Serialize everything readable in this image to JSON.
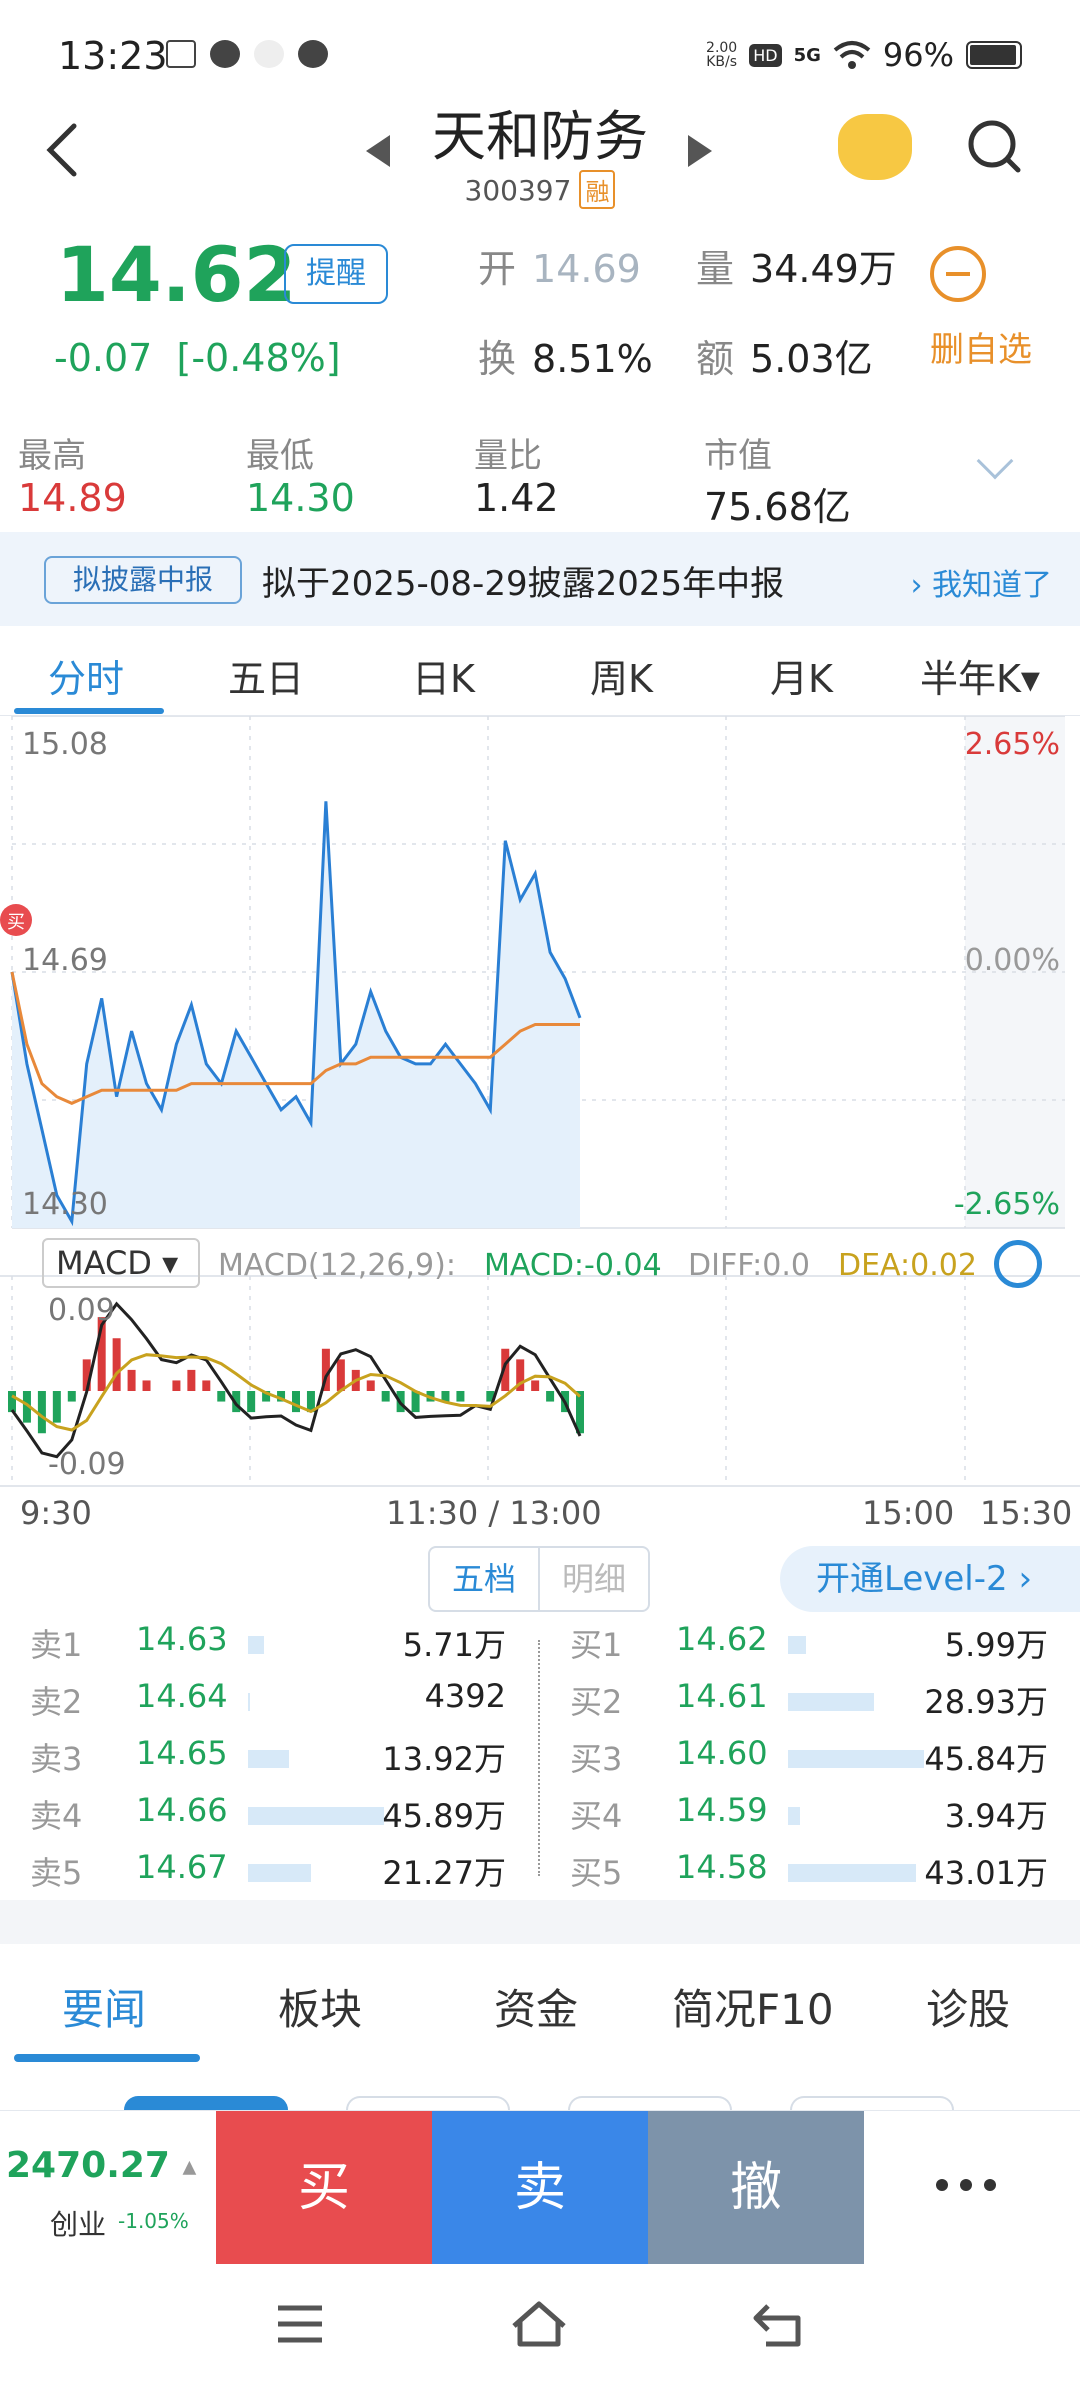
{
  "status_bar": {
    "time": "13:23",
    "net_speed_top": "2.00",
    "net_speed_bottom": "KB/s",
    "hd": "HD",
    "signal": "5G",
    "battery": "96%"
  },
  "header": {
    "stock_name": "天和防务",
    "stock_code": "300397",
    "margin_tag": "融"
  },
  "quote": {
    "price": "14.62",
    "remind_label": "提醒",
    "change": "-0.07",
    "change_pct": "[-0.48%]",
    "open_label": "开",
    "open_value": "14.69",
    "volume_label": "量",
    "volume_value": "34.49万",
    "turnover_label": "换",
    "turnover_value": "8.51%",
    "amount_label": "额",
    "amount_value": "5.03亿",
    "remove_watch_label": "删自选"
  },
  "stats": [
    {
      "label": "最高",
      "value": "14.89",
      "color": "#d93a3a"
    },
    {
      "label": "最低",
      "value": "14.30",
      "color": "#1fa35b"
    },
    {
      "label": "量比",
      "value": "1.42",
      "color": "#222222"
    },
    {
      "label": "市值",
      "value": "75.68亿",
      "color": "#222222"
    }
  ],
  "banner": {
    "tag": "拟披露中报",
    "text": "拟于2025-08-29披露2025年中报",
    "action": "我知道了"
  },
  "period_tabs": [
    "分时",
    "五日",
    "日K",
    "周K",
    "月K",
    "半年K▾"
  ],
  "price_chart": {
    "y_top": "15.08",
    "y_mid": "14.69",
    "y_bottom": "14.30",
    "pct_top": "2.65%",
    "pct_mid": "0.00%",
    "pct_bottom": "-2.65%",
    "marker": "买"
  },
  "macd": {
    "selector": "MACD",
    "params": "MACD(12,26,9):",
    "macd_value": "MACD:-0.04",
    "diff_value": "DIFF:0.0",
    "dea_value": "DEA:0.02",
    "y_top": "0.09",
    "y_bottom": "-0.09"
  },
  "time_axis": [
    "9:30",
    "11:30 / 13:00",
    "15:00",
    "15:30"
  ],
  "chart_data": [
    {
      "type": "line",
      "title": "",
      "ylim": [
        14.3,
        15.08
      ],
      "series": [
        {
          "values": [
            14.69,
            14.55,
            14.45,
            14.35,
            14.31,
            14.55,
            14.65,
            14.5,
            14.6,
            14.52,
            14.48,
            14.58,
            14.64,
            14.55,
            14.52,
            14.6,
            14.56,
            14.52,
            14.48,
            14.5,
            14.46,
            14.95,
            14.55,
            14.58,
            14.66,
            14.6,
            14.56,
            14.55,
            14.55,
            14.58,
            14.55,
            14.52,
            14.48,
            14.89,
            14.8,
            14.84,
            14.72,
            14.68,
            14.62
          ]
        },
        {
          "values": [
            14.69,
            14.58,
            14.52,
            14.5,
            14.49,
            14.5,
            14.51,
            14.51,
            14.51,
            14.51,
            14.51,
            14.51,
            14.52,
            14.52,
            14.52,
            14.52,
            14.52,
            14.52,
            14.52,
            14.52,
            14.52,
            14.54,
            14.55,
            14.55,
            14.56,
            14.56,
            14.56,
            14.56,
            14.56,
            14.56,
            14.56,
            14.56,
            14.56,
            14.58,
            14.6,
            14.61,
            14.61,
            14.61,
            14.61
          ]
        }
      ]
    },
    {
      "type": "bar",
      "title": "",
      "ylim": [
        -0.09,
        0.09
      ],
      "values": [
        -0.02,
        -0.03,
        -0.04,
        -0.03,
        -0.01,
        0.03,
        0.07,
        0.05,
        0.02,
        0.01,
        0.0,
        0.01,
        0.02,
        0.01,
        -0.01,
        -0.02,
        -0.02,
        -0.01,
        -0.01,
        -0.02,
        -0.02,
        0.04,
        0.03,
        0.02,
        0.01,
        -0.01,
        -0.02,
        -0.02,
        -0.01,
        -0.01,
        -0.01,
        0.0,
        -0.01,
        0.04,
        0.03,
        0.01,
        -0.01,
        -0.02,
        -0.04
      ]
    }
  ],
  "orderbook": {
    "tab_five": "五档",
    "tab_detail": "明细",
    "level2": "开通Level-2 ›",
    "sell": [
      {
        "label": "卖1",
        "price": "14.63",
        "volume": "5.71万",
        "bar": 0.12
      },
      {
        "label": "卖2",
        "price": "14.64",
        "volume": "4392",
        "bar": 0.01
      },
      {
        "label": "卖3",
        "price": "14.65",
        "volume": "13.92万",
        "bar": 0.3
      },
      {
        "label": "卖4",
        "price": "14.66",
        "volume": "45.89万",
        "bar": 1.0
      },
      {
        "label": "卖5",
        "price": "14.67",
        "volume": "21.27万",
        "bar": 0.46
      }
    ],
    "buy": [
      {
        "label": "买1",
        "price": "14.62",
        "volume": "5.99万",
        "bar": 0.13
      },
      {
        "label": "买2",
        "price": "14.61",
        "volume": "28.93万",
        "bar": 0.63
      },
      {
        "label": "买3",
        "price": "14.60",
        "volume": "45.84万",
        "bar": 1.0
      },
      {
        "label": "买4",
        "price": "14.59",
        "volume": "3.94万",
        "bar": 0.09
      },
      {
        "label": "买5",
        "price": "14.58",
        "volume": "43.01万",
        "bar": 0.94
      }
    ]
  },
  "news_tabs": [
    "要闻",
    "板块",
    "资金",
    "简况F10",
    "诊股"
  ],
  "bottom_bar": {
    "index_value": "2470.27",
    "index_arrow": "▲",
    "index_name": "创业",
    "index_change": "-1.05%",
    "buy": "买",
    "sell": "卖",
    "cancel": "撤"
  },
  "colors": {
    "up": "#d93a3a",
    "down": "#1fa35b",
    "accent": "#2a8ad6",
    "buy_button": "#e84c4f",
    "sell_button": "#3a87e8",
    "cancel_button": "#7d93aa"
  }
}
